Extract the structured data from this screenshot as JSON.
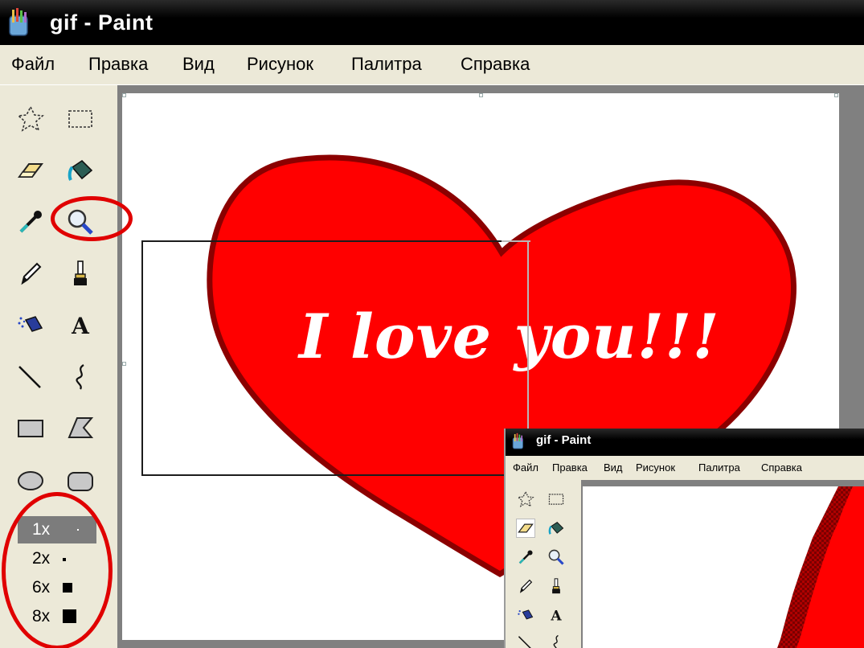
{
  "window": {
    "title": "gif - Paint",
    "menu": [
      "Файл",
      "Правка",
      "Вид",
      "Рисунок",
      "Палитра",
      "Справка"
    ]
  },
  "toolbox": {
    "tools": [
      "free-select",
      "rect-select",
      "eraser",
      "fill-bucket",
      "color-picker",
      "magnifier",
      "pencil",
      "brush",
      "airbrush",
      "text",
      "line",
      "curve",
      "rectangle",
      "polygon",
      "ellipse",
      "rounded-rectangle"
    ],
    "selected_tool": "magnifier",
    "zoom_options": [
      "1x",
      "2x",
      "6x",
      "8x"
    ],
    "selected_zoom": "1x"
  },
  "canvas": {
    "text": "I love you!!!",
    "heart_color": "#ff0000",
    "outline_color": "#8b0000"
  },
  "inset_window": {
    "title": "gif - Paint",
    "menu": [
      "Файл",
      "Правка",
      "Вид",
      "Рисунок",
      "Палитра",
      "Справка"
    ]
  },
  "colors": {
    "annotation": "#e00000",
    "titlebar": "#000000"
  }
}
